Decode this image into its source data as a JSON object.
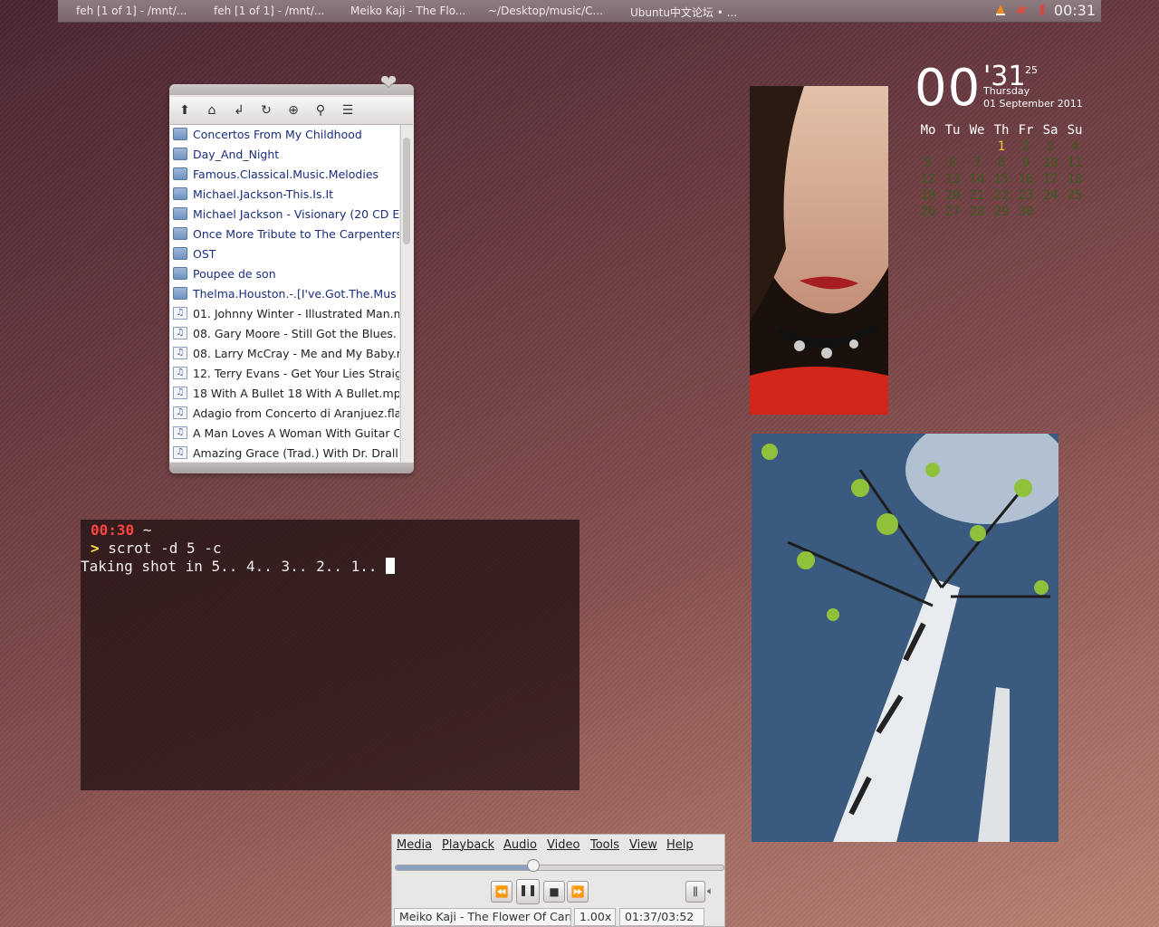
{
  "panel": {
    "tasks": [
      "feh [1 of 1] - /mnt/...",
      "feh [1 of 1] - /mnt/...",
      "Meiko Kaji - The Flo...",
      "~/Desktop/music/C...",
      "Ubuntu中文论坛 • ..."
    ],
    "clock": "00:31"
  },
  "file_manager": {
    "items": [
      {
        "type": "folder",
        "name": "Concertos From My Childhood"
      },
      {
        "type": "folder",
        "name": "Day_And_Night"
      },
      {
        "type": "folder",
        "name": "Famous.Classical.Music.Melodies"
      },
      {
        "type": "folder",
        "name": "Michael.Jackson-This.Is.It"
      },
      {
        "type": "folder",
        "name": "Michael Jackson - Visionary (20 CD E"
      },
      {
        "type": "folder",
        "name": "Once More Tribute to The Carpenters"
      },
      {
        "type": "folder",
        "name": "OST"
      },
      {
        "type": "folder",
        "name": "Poupee de son"
      },
      {
        "type": "folder",
        "name": "Thelma.Houston.-.[I've.Got.The.Mus"
      },
      {
        "type": "file",
        "name": "01. Johnny Winter - Illustrated Man.m"
      },
      {
        "type": "file",
        "name": "08. Gary Moore - Still Got the Blues."
      },
      {
        "type": "file",
        "name": "08. Larry McCray - Me and My Baby.r"
      },
      {
        "type": "file",
        "name": "12. Terry Evans - Get Your Lies Straig"
      },
      {
        "type": "file",
        "name": "18 With A Bullet 18 With A Bullet.mp"
      },
      {
        "type": "file",
        "name": "Adagio from Concerto di Aranjuez.fla"
      },
      {
        "type": "file",
        "name": "A Man Loves A Woman With Guitar C"
      },
      {
        "type": "file",
        "name": "Amazing Grace (Trad.) With Dr. Drall"
      }
    ]
  },
  "terminal": {
    "time": "00:30",
    "cwd": "~",
    "prompt_symbol": ">",
    "command": "scrot -d 5 -c",
    "output": "Taking shot in 5.. 4.. 3.. 2.. 1.. "
  },
  "clock_widget": {
    "hour": "00",
    "minute": "'31",
    "second": "25",
    "weekday": "Thursday",
    "date": "01 September 2011",
    "weekday_headers": [
      "Mo",
      "Tu",
      "We",
      "Th",
      "Fr",
      "Sa",
      "Su"
    ],
    "days": [
      "1",
      "2",
      "3",
      "4",
      "5",
      "6",
      "7",
      "8",
      "9",
      "10",
      "11",
      "12",
      "13",
      "14",
      "15",
      "16",
      "17",
      "18",
      "19",
      "20",
      "21",
      "22",
      "23",
      "24",
      "25",
      "26",
      "27",
      "28",
      "29",
      "30"
    ],
    "first_weekday_index": 3,
    "today": "1"
  },
  "media_player": {
    "menu": [
      "Media",
      "Playback",
      "Audio",
      "Video",
      "Tools",
      "View",
      "Help"
    ],
    "progress": 0.42,
    "track": "Meiko Kaji - The Flower Of Carnage",
    "speed": "1.00x",
    "time": "01:37/03:52"
  },
  "colors": {
    "panel": "#7f6b70",
    "term_time": "#ff4444",
    "term_prompt": "#ffe04a",
    "cal_today": "#f3c531",
    "cal_days": "#3a5a1e"
  }
}
